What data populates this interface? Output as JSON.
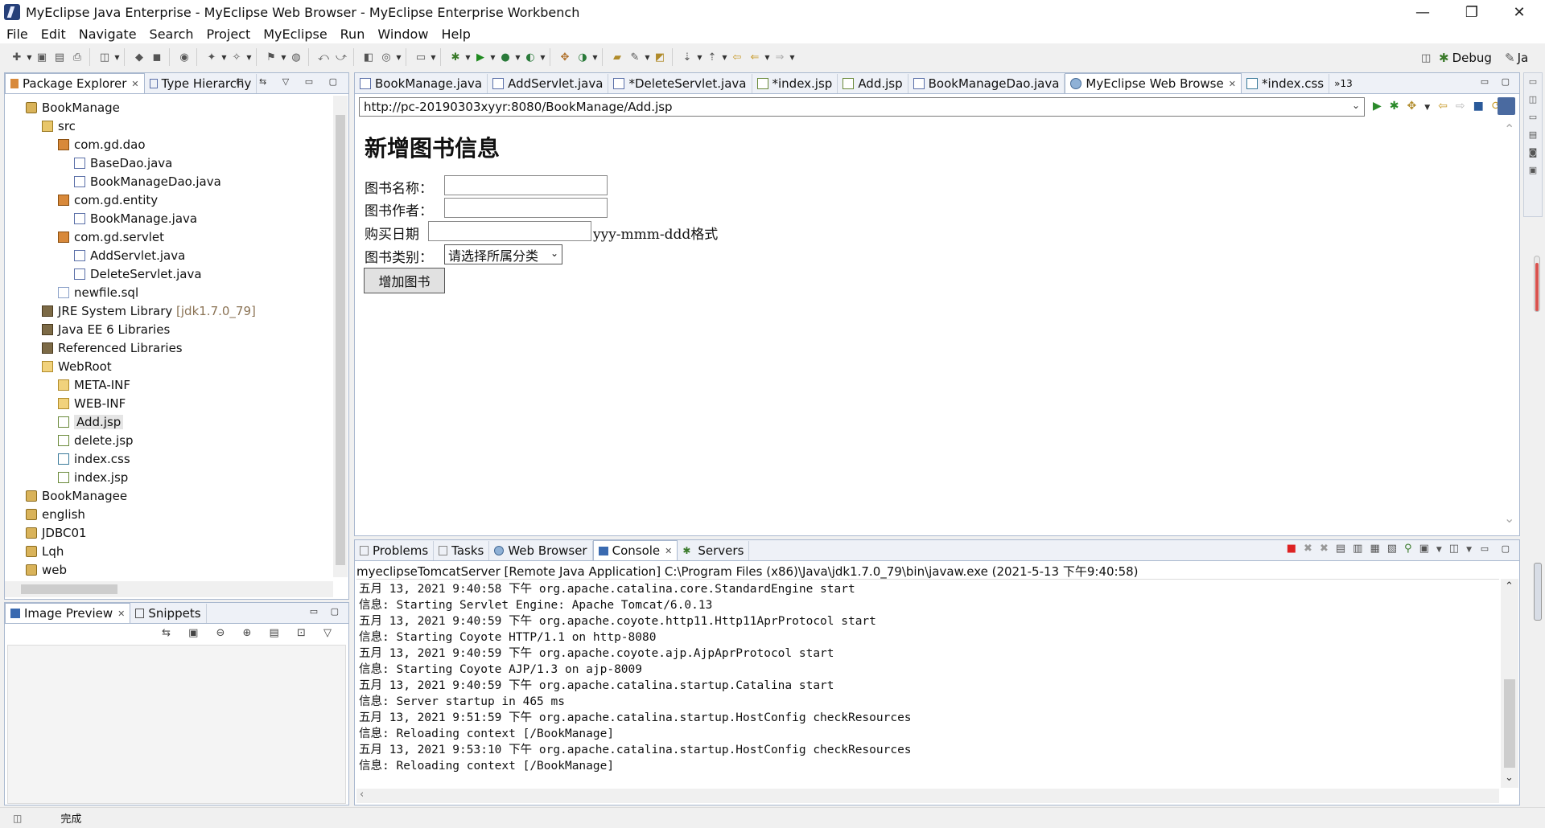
{
  "window": {
    "title": "MyEclipse Java Enterprise - MyEclipse Web Browser - MyEclipse Enterprise Workbench",
    "minimize": "—",
    "restore": "❐",
    "close": "✕"
  },
  "menu": [
    "File",
    "Edit",
    "Navigate",
    "Search",
    "Project",
    "MyEclipse",
    "Run",
    "Window",
    "Help"
  ],
  "perspectives": {
    "debug": "Debug",
    "java_partial": "Ja"
  },
  "package_explorer": {
    "tabs": [
      "Package Explorer",
      "Type Hierarchy"
    ],
    "tree": [
      {
        "label": "BookManage",
        "icon": "project-icon"
      },
      {
        "label": "src",
        "icon": "source-folder-icon"
      },
      {
        "label": "com.gd.dao",
        "icon": "package-icon"
      },
      {
        "label": "BaseDao.java",
        "icon": "java-file-icon"
      },
      {
        "label": "BookManageDao.java",
        "icon": "java-file-icon"
      },
      {
        "label": "com.gd.entity",
        "icon": "package-icon"
      },
      {
        "label": "BookManage.java",
        "icon": "java-file-icon"
      },
      {
        "label": "com.gd.servlet",
        "icon": "package-icon"
      },
      {
        "label": "AddServlet.java",
        "icon": "java-file-icon"
      },
      {
        "label": "DeleteServlet.java",
        "icon": "java-file-icon"
      },
      {
        "label": "newfile.sql",
        "icon": "sql-file-icon"
      },
      {
        "label": "JRE System Library",
        "suffix": "[jdk1.7.0_79]",
        "icon": "library-icon"
      },
      {
        "label": "Java EE 6 Libraries",
        "icon": "library-icon"
      },
      {
        "label": "Referenced Libraries",
        "icon": "library-icon"
      },
      {
        "label": "WebRoot",
        "icon": "folder-icon"
      },
      {
        "label": "META-INF",
        "icon": "folder-icon"
      },
      {
        "label": "WEB-INF",
        "icon": "folder-icon"
      },
      {
        "label": "Add.jsp",
        "icon": "jsp-file-icon",
        "selected": true
      },
      {
        "label": "delete.jsp",
        "icon": "jsp-file-icon"
      },
      {
        "label": "index.css",
        "icon": "css-file-icon"
      },
      {
        "label": "index.jsp",
        "icon": "jsp-file-icon"
      },
      {
        "label": "BookManagee",
        "icon": "project-icon"
      },
      {
        "label": "english",
        "icon": "project-icon"
      },
      {
        "label": "JDBC01",
        "icon": "project-icon"
      },
      {
        "label": "Lqh",
        "icon": "project-icon"
      },
      {
        "label": "web",
        "icon": "project-icon"
      }
    ]
  },
  "image_preview": {
    "tabs": [
      "Image Preview",
      "Snippets"
    ]
  },
  "editor": {
    "tabs": [
      {
        "label": "BookManage.java"
      },
      {
        "label": "AddServlet.java"
      },
      {
        "label": "*DeleteServlet.java"
      },
      {
        "label": "*index.jsp"
      },
      {
        "label": "Add.jsp"
      },
      {
        "label": "BookManageDao.java"
      },
      {
        "label": "MyEclipse Web Browse",
        "active": true
      },
      {
        "label": "*index.css"
      }
    ],
    "overflow": "»13",
    "url": "http://pc-20190303xyyr:8080/BookManage/Add.jsp"
  },
  "webpage": {
    "heading": "新增图书信息",
    "name_label": "图书名称：",
    "author_label": "图书作者：",
    "date_label": "购买日期",
    "date_hint": "yyy-mmm-ddd格式",
    "category_label": "图书类别：",
    "category_selected": "请选择所属分类",
    "submit": "增加图书"
  },
  "console": {
    "tabs": [
      "Problems",
      "Tasks",
      "Web Browser",
      "Console",
      "Servers"
    ],
    "header": "myeclipseTomcatServer [Remote Java Application] C:\\Program Files (x86)\\Java\\jdk1.7.0_79\\bin\\javaw.exe (2021-5-13 下午9:40:58)",
    "lines": [
      "五月 13, 2021 9:40:58 下午 org.apache.catalina.core.StandardEngine start",
      "信息: Starting Servlet Engine: Apache Tomcat/6.0.13",
      "五月 13, 2021 9:40:59 下午 org.apache.coyote.http11.Http11AprProtocol start",
      "信息: Starting Coyote HTTP/1.1 on http-8080",
      "五月 13, 2021 9:40:59 下午 org.apache.coyote.ajp.AjpAprProtocol start",
      "信息: Starting Coyote AJP/1.3 on ajp-8009",
      "五月 13, 2021 9:40:59 下午 org.apache.catalina.startup.Catalina start",
      "信息: Server startup in 465 ms",
      "五月 13, 2021 9:51:59 下午 org.apache.catalina.startup.HostConfig checkResources",
      "信息: Reloading context [/BookManage]",
      "五月 13, 2021 9:53:10 下午 org.apache.catalina.startup.HostConfig checkResources",
      "信息: Reloading context [/BookManage]"
    ]
  },
  "status": {
    "text": "完成"
  }
}
